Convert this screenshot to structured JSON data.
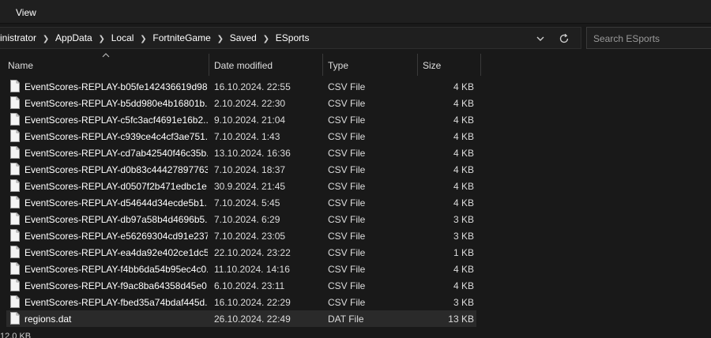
{
  "menubar": {
    "items": [
      {
        "label": "View"
      }
    ]
  },
  "address": {
    "crumbs": [
      "inistrator",
      "AppData",
      "Local",
      "FortniteGame",
      "Saved",
      "ESports"
    ]
  },
  "search": {
    "placeholder": "Search ESports"
  },
  "columns": {
    "name": "Name",
    "date": "Date modified",
    "type": "Type",
    "size": "Size"
  },
  "files": [
    {
      "name": "EventScores-REPLAY-b05fe142436619d98...",
      "date": "16.10.2024. 22:55",
      "type": "CSV File",
      "size": "4 KB"
    },
    {
      "name": "EventScores-REPLAY-b5dd980e4b16801b...",
      "date": "2.10.2024. 22:30",
      "type": "CSV File",
      "size": "4 KB"
    },
    {
      "name": "EventScores-REPLAY-c5fc3acf4691e16b2...",
      "date": "9.10.2024. 21:04",
      "type": "CSV File",
      "size": "4 KB"
    },
    {
      "name": "EventScores-REPLAY-c939ce4c4cf3ae751...",
      "date": "7.10.2024. 1:43",
      "type": "CSV File",
      "size": "4 KB"
    },
    {
      "name": "EventScores-REPLAY-cd7ab42540f46c35b...",
      "date": "13.10.2024. 16:36",
      "type": "CSV File",
      "size": "4 KB"
    },
    {
      "name": "EventScores-REPLAY-d0b83c44427897763...",
      "date": "7.10.2024. 18:37",
      "type": "CSV File",
      "size": "4 KB"
    },
    {
      "name": "EventScores-REPLAY-d0507f2b471edbc1e...",
      "date": "30.9.2024. 21:45",
      "type": "CSV File",
      "size": "4 KB"
    },
    {
      "name": "EventScores-REPLAY-d54644d34ecde5b1...",
      "date": "7.10.2024. 5:45",
      "type": "CSV File",
      "size": "4 KB"
    },
    {
      "name": "EventScores-REPLAY-db97a58b4d4696b5...",
      "date": "7.10.2024. 6:29",
      "type": "CSV File",
      "size": "3 KB"
    },
    {
      "name": "EventScores-REPLAY-e56269304cd91e237...",
      "date": "7.10.2024. 23:05",
      "type": "CSV File",
      "size": "3 KB"
    },
    {
      "name": "EventScores-REPLAY-ea4da92e402ce1dc5...",
      "date": "22.10.2024. 23:22",
      "type": "CSV File",
      "size": "1 KB"
    },
    {
      "name": "EventScores-REPLAY-f4bb6da54b95ec4c0...",
      "date": "11.10.2024. 14:16",
      "type": "CSV File",
      "size": "4 KB"
    },
    {
      "name": "EventScores-REPLAY-f9ac8ba64358d45e0...",
      "date": "6.10.2024. 23:11",
      "type": "CSV File",
      "size": "4 KB"
    },
    {
      "name": "EventScores-REPLAY-fbed35a74bdaf445d...",
      "date": "16.10.2024. 22:29",
      "type": "CSV File",
      "size": "3 KB"
    },
    {
      "name": "regions.dat",
      "date": "26.10.2024. 22:49",
      "type": "DAT File",
      "size": "13 KB",
      "selected": true
    }
  ],
  "status": {
    "text": "12,0 KB"
  },
  "icons": {
    "file": "document-icon",
    "chevron": "chevron-down-icon",
    "refresh": "refresh-icon",
    "sort": "sort-ascending-icon"
  },
  "colors": {
    "background": "#191919",
    "selected_row": "#2a2a2a",
    "text": "#ffffff"
  }
}
